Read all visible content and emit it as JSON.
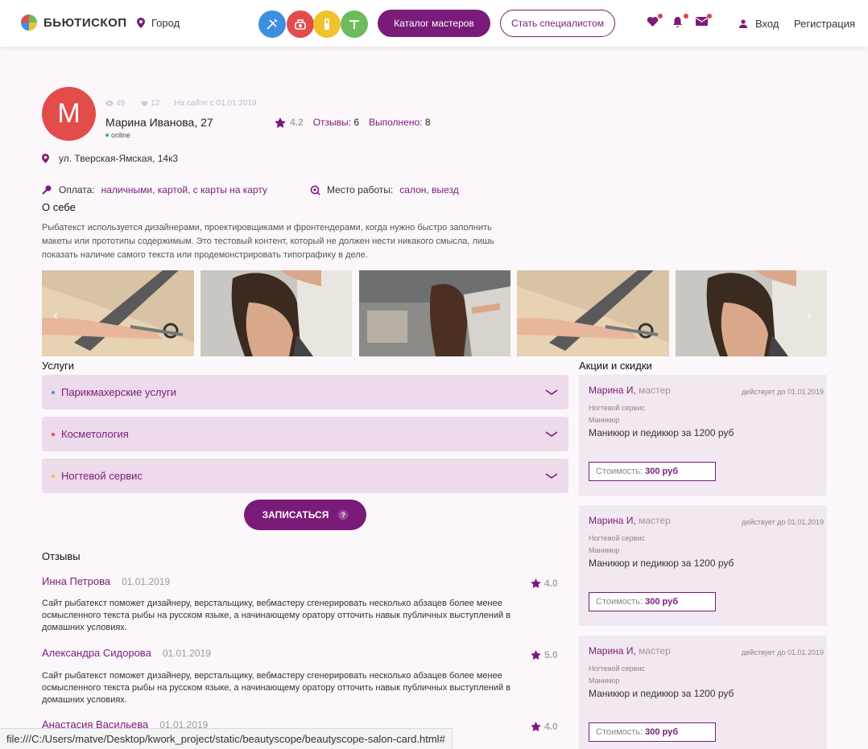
{
  "header": {
    "logo_text": "БЬЮТИСКОП",
    "city": "Город",
    "catalog_button": "Каталог мастеров",
    "become_button": "Стать специалистом",
    "login": "Вход",
    "register": "Регистрация",
    "categories": [
      {
        "icon": "hairdresser-icon",
        "color": "#3e8fe0"
      },
      {
        "icon": "cosmetology-icon",
        "color": "#e24c4b"
      },
      {
        "icon": "nails-icon",
        "color": "#f2c12e"
      },
      {
        "icon": "massage-icon",
        "color": "#6dbb5d"
      }
    ]
  },
  "profile": {
    "avatar_letter": "М",
    "views": "49",
    "likes": "12",
    "since": "На сайте с 01.01.2019",
    "name": "Марина Иванова, 27",
    "status": "online",
    "rating": "4.2",
    "reviews_label": "Отзывы:",
    "reviews_count": "6",
    "done_label": "Выполнено:",
    "done_count": "8",
    "address": "ул. Тверская-Ямская, 14к3",
    "payment_label": "Оплата:",
    "payment_value": "наличными, картой, с карты на карту",
    "workplace_label": "Место работы:",
    "workplace_value": "салон, выезд",
    "about_title": "О себе",
    "about_text": "Рыбатекст используется дизайнерами, проектировщиками и фронтендерами, когда нужно быстро заполнить макеты или прототипы содержимым. Это тестовый контент, который не должен нести никакого смысла, лишь показать наличие самого текста или продемонстрировать типографику в деле."
  },
  "services": {
    "title": "Услуги",
    "items": [
      {
        "label": "Парикмахерские услуги",
        "color": "#3e8fe0"
      },
      {
        "label": "Косметология",
        "color": "#e24c4b"
      },
      {
        "label": "Ногтевой сервис",
        "color": "#f2c12e"
      }
    ],
    "book_button": "ЗАПИСАТЬСЯ",
    "help": "?"
  },
  "reviews": {
    "title": "Отзывы",
    "items": [
      {
        "name": "Инна Петрова",
        "date": "01.01.2019",
        "rating": "4.0",
        "text": "Сайт рыбатекст поможет дизайнеру, верстальщику, вебмастеру сгенерировать несколько абзацев более менее осмысленного текста рыбы на русском языке, а начинающему оратору отточить навык публичных выступлений в домашних условиях."
      },
      {
        "name": "Александра Сидорова",
        "date": "01.01.2019",
        "rating": "5.0",
        "text": "Сайт рыбатекст поможет дизайнеру, верстальщику, вебмастеру сгенерировать несколько абзацев более менее осмысленного текста рыбы на русском языке, а начинающему оратору отточить навык публичных выступлений в домашних условиях."
      },
      {
        "name": "Анастасия Васильева",
        "date": "01.01.2019",
        "rating": "4.0"
      }
    ]
  },
  "promos": {
    "title": "Акции и скидки",
    "items": [
      {
        "name": "Марина И,",
        "role": "мастер",
        "valid": "действует до 01.01.2019",
        "category": "Ногтевой сервис",
        "sub": "Маникюр",
        "desc": "Маникюр и педикюр за 1200 руб",
        "price_label": "Стоимость:",
        "price": "300 руб"
      },
      {
        "name": "Марина И,",
        "role": "мастер",
        "valid": "действует до 01.01.2019",
        "category": "Ногтевой сервис",
        "sub": "Маникюр",
        "desc": "Маникюр и педикюр за 1200 руб",
        "price_label": "Стоимость:",
        "price": "300 руб"
      },
      {
        "name": "Марина И,",
        "role": "мастер",
        "valid": "действует до 01.01.2019",
        "category": "Ногтевой сервис",
        "sub": "Маникюр",
        "desc": "Маникюр и педикюр за 1200 руб",
        "price_label": "Стоимость:",
        "price": "300 руб"
      }
    ]
  },
  "statusbar": "file:///C:/Users/matve/Desktop/kwork_project/static/beautyscope/beautyscope-salon-card.html#"
}
